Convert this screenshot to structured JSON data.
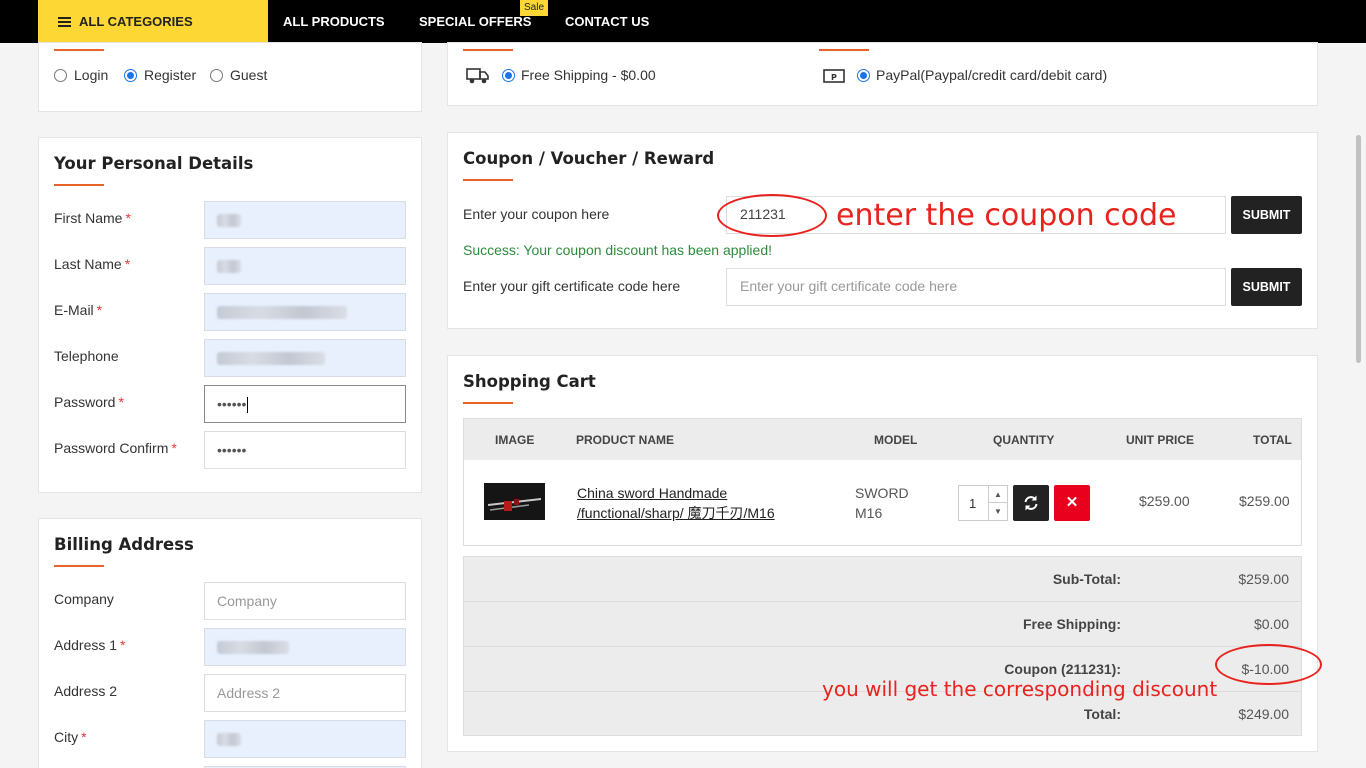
{
  "nav": {
    "all_categories": "ALL CATEGORIES",
    "links": [
      "ALL PRODUCTS",
      "SPECIAL OFFERS",
      "CONTACT US"
    ],
    "sale_badge": "Sale"
  },
  "account": {
    "options": [
      "Login",
      "Register",
      "Guest"
    ],
    "selected": "Register"
  },
  "shipping": {
    "label": "Free Shipping - $0.00"
  },
  "payment": {
    "label": "PayPal(Paypal/credit card/debit card)"
  },
  "personal": {
    "title": "Your Personal Details",
    "fields": {
      "first_name": "First Name",
      "last_name": "Last Name",
      "email": "E-Mail",
      "telephone": "Telephone",
      "password": "Password",
      "password_confirm": "Password Confirm"
    },
    "password_value": "••••••",
    "password_confirm_value": "••••••"
  },
  "billing": {
    "title": "Billing Address",
    "fields": {
      "company": "Company",
      "address1": "Address 1",
      "address2": "Address 2",
      "city": "City"
    },
    "placeholders": {
      "company": "Company",
      "address2": "Address 2"
    }
  },
  "coupon": {
    "title": "Coupon / Voucher / Reward",
    "coupon_label": "Enter your coupon here",
    "coupon_value": "211231",
    "submit": "SUBMIT",
    "success": "Success: Your coupon discount has been applied!",
    "gift_label": "Enter your gift certificate code here",
    "gift_placeholder": "Enter your gift certificate code here"
  },
  "annotations": {
    "coupon_hint": "enter the coupon code",
    "discount_hint": "you will get the corresponding discount"
  },
  "cart": {
    "title": "Shopping Cart",
    "headers": [
      "IMAGE",
      "PRODUCT NAME",
      "MODEL",
      "QUANTITY",
      "UNIT PRICE",
      "TOTAL"
    ],
    "item": {
      "name_line1": "China sword Handmade",
      "name_line2": "/functional/sharp/ 魔刀千刃/M16",
      "model_line1": "SWORD",
      "model_line2": "M16",
      "quantity": "1",
      "unit_price": "$259.00",
      "total": "$259.00"
    },
    "totals": [
      {
        "label": "Sub-Total:",
        "value": "$259.00"
      },
      {
        "label": "Free Shipping:",
        "value": "$0.00"
      },
      {
        "label": "Coupon (211231):",
        "value": "$-10.00"
      },
      {
        "label": "Total:",
        "value": "$249.00"
      }
    ]
  },
  "colors": {
    "accent_yellow": "#fdd835",
    "accent_orange": "#e8632b",
    "annotation_red": "#e8231d",
    "danger": "#e8001c",
    "dark_button": "#222222"
  }
}
